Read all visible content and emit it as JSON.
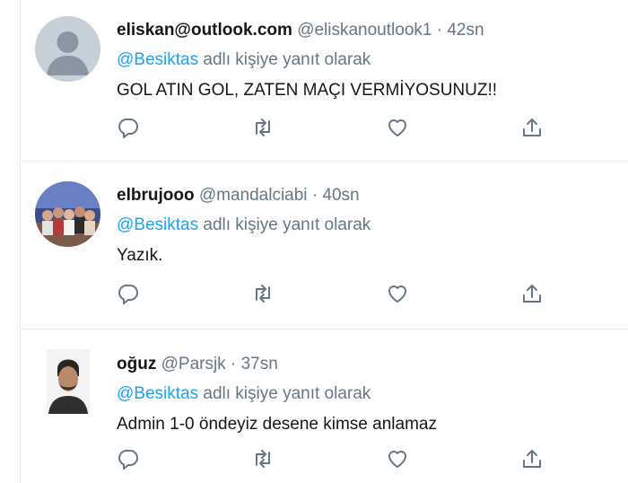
{
  "tweets": [
    {
      "name": "eliskan@outlook.com",
      "handle": "@eliskanoutlook1",
      "dot": "·",
      "time": "42sn",
      "reply_mention": "@Besiktas",
      "reply_suffix": " adlı kişiye yanıt olarak",
      "text": "GOL ATIN GOL, ZATEN MAÇI VERMİYOSUNUZ!!",
      "avatar": "default-avatar"
    },
    {
      "name": "elbrujooo",
      "handle": "@mandalciabi",
      "dot": "·",
      "time": "40sn",
      "reply_mention": "@Besiktas",
      "reply_suffix": " adlı kişiye yanıt olarak",
      "text": "Yazık.",
      "avatar": "group-photo-avatar"
    },
    {
      "name": "oğuz",
      "handle": "@Parsjk",
      "dot": "·",
      "time": "37sn",
      "reply_mention": "@Besiktas",
      "reply_suffix": " adlı kişiye yanıt olarak",
      "text": "Admin 1-0 öndeyiz desene kimse anlamaz",
      "avatar": "person-photo-avatar"
    }
  ],
  "icons": [
    "reply-icon",
    "retweet-icon",
    "like-icon",
    "share-icon"
  ],
  "colors": {
    "link": "#1da1f2",
    "secondary": "#657786",
    "text": "#14171a",
    "divider": "#e6ecf0"
  }
}
